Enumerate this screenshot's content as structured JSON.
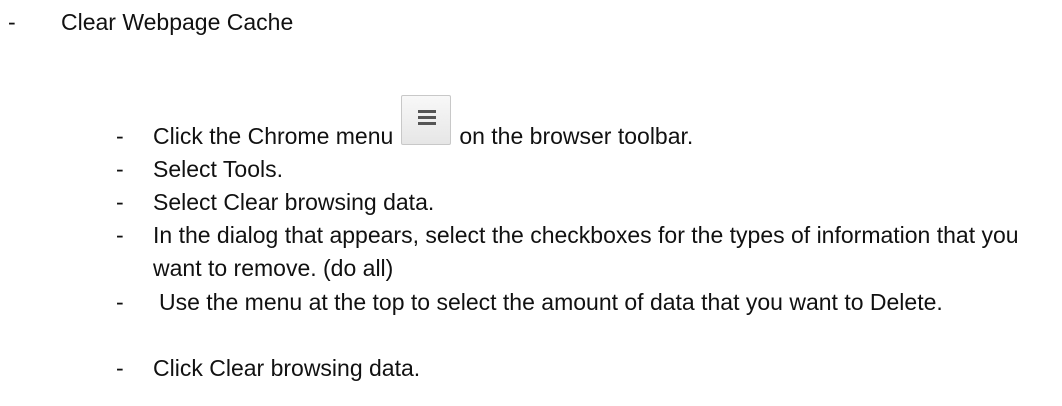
{
  "heading": {
    "dash": "-",
    "text": "Clear Webpage Cache"
  },
  "steps": [
    {
      "dash": "-",
      "before": "Click the Chrome menu",
      "icon": "chrome-menu-icon",
      "after": "on the browser toolbar."
    },
    {
      "dash": "-",
      "text": "Select Tools."
    },
    {
      "dash": "-",
      "text": "Select Clear browsing data."
    },
    {
      "dash": "-",
      "text": "In the dialog that appears, select the checkboxes for the types of information that you want to remove. (do all)"
    },
    {
      "dash": "-",
      "text": "Use the menu at the top to select the amount of data that you want to Delete."
    },
    {
      "dash": "-",
      "text": "Click Clear browsing data."
    }
  ]
}
